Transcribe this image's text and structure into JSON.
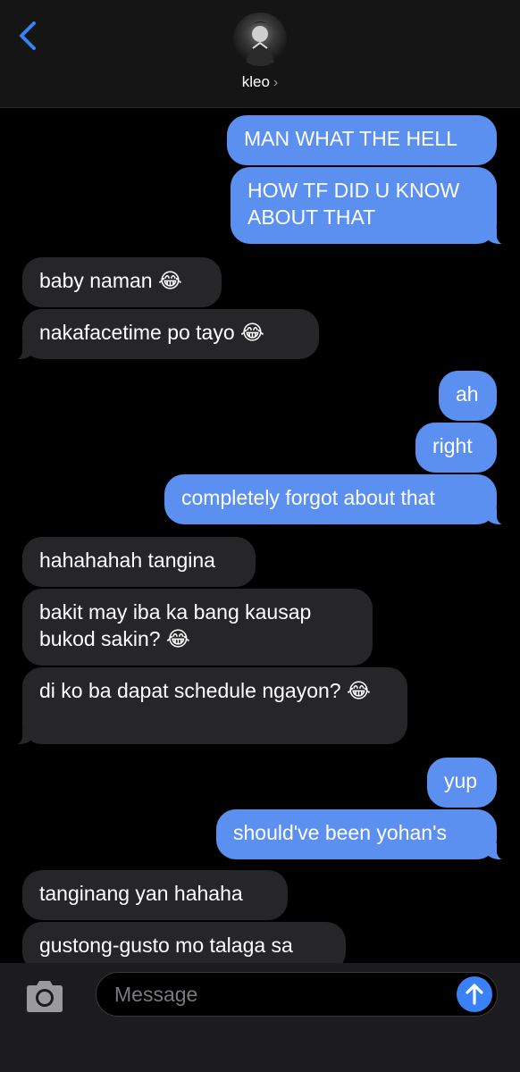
{
  "header": {
    "contact_name": "kleo",
    "contact_chevron": "›",
    "back_icon": "chevron-left-icon",
    "accent": "#3a80f6"
  },
  "messages": [
    {
      "side": "out",
      "text": "MAN WHAT THE HELL"
    },
    {
      "side": "out",
      "text": "HOW TF DID U KNOW ABOUT THAT"
    },
    {
      "side": "in",
      "text": "baby naman 😂"
    },
    {
      "side": "in",
      "text": "nakafacetime po tayo 😂"
    },
    {
      "side": "out",
      "text": "ah"
    },
    {
      "side": "out",
      "text": "right"
    },
    {
      "side": "out",
      "text": "completely forgot about that"
    },
    {
      "side": "in",
      "text": "hahahahah tangina"
    },
    {
      "side": "in",
      "text": "bakit may iba ka bang kausap bukod sakin? 😂"
    },
    {
      "side": "in",
      "text": "di ko ba dapat schedule ngayon? 😂"
    },
    {
      "side": "out",
      "text": "yup"
    },
    {
      "side": "out",
      "text": "should've been yohan's"
    },
    {
      "side": "in",
      "text": "tanginang yan hahaha"
    },
    {
      "side": "in",
      "text": "gustong-gusto mo talaga sa"
    }
  ],
  "composer": {
    "placeholder": "Message",
    "camera_icon": "camera-icon",
    "send_icon": "send-arrow-icon"
  },
  "colors": {
    "outgoing_bubble": "#5b8ff0",
    "incoming_bubble": "#262628",
    "background": "#000000"
  }
}
